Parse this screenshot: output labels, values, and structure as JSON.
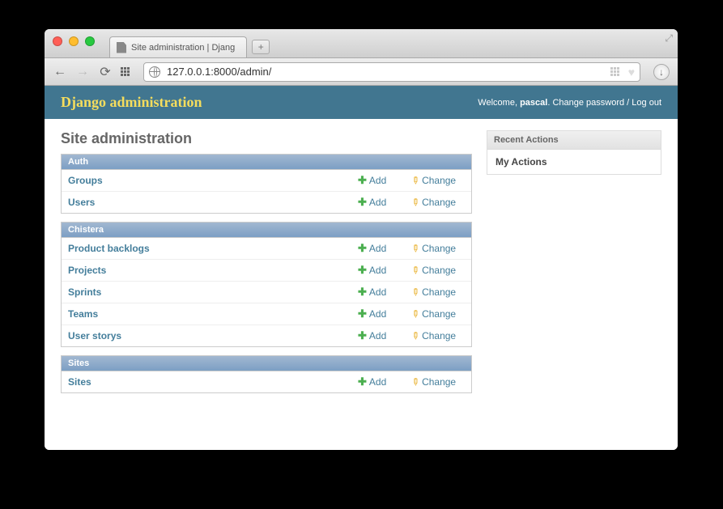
{
  "browser": {
    "tab_title": "Site administration | Djang",
    "new_tab": "+",
    "url": "127.0.0.1:8000/admin/"
  },
  "header": {
    "brand": "Django administration",
    "welcome": "Welcome,",
    "user": "pascal",
    "change_password": "Change password",
    "logout": "Log out"
  },
  "page_title": "Site administration",
  "add_label": "Add",
  "change_label": "Change",
  "apps": [
    {
      "name": "Auth",
      "models": [
        "Groups",
        "Users"
      ]
    },
    {
      "name": "Chistera",
      "models": [
        "Product backlogs",
        "Projects",
        "Sprints",
        "Teams",
        "User storys"
      ]
    },
    {
      "name": "Sites",
      "models": [
        "Sites"
      ]
    }
  ],
  "sidebar": {
    "recent_title": "Recent Actions",
    "my_actions": "My Actions"
  }
}
